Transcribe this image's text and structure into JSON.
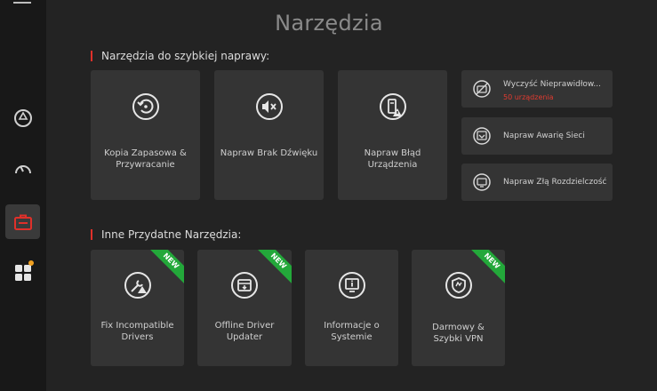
{
  "page_title": "Narzędzia",
  "sections": {
    "quick_fix_title": "Narzędzia do szybkiej naprawy:",
    "other_tools_title": "Inne Przydatne Narzędzia:"
  },
  "quick_tools": [
    {
      "label": "Kopia Zapasowa & Przywracanie",
      "icon": "backup-restore-icon"
    },
    {
      "label": "Napraw Brak Dźwięku",
      "icon": "speaker-mute-icon"
    },
    {
      "label": "Napraw Błąd Urządzenia",
      "icon": "device-error-icon"
    }
  ],
  "side_tools": [
    {
      "label": "Wyczyść Nieprawidłow...",
      "sub": "50 urządzenia",
      "icon": "invalid-device-icon"
    },
    {
      "label": "Napraw Awarię Sieci",
      "icon": "network-icon"
    },
    {
      "label": "Napraw Złą Rozdzielczość",
      "icon": "resolution-icon"
    }
  ],
  "other_tools": [
    {
      "label": "Fix Incompatible Drivers",
      "badge": "NEW",
      "icon": "wrench-warning-icon"
    },
    {
      "label": "Offline Driver Updater",
      "badge": "NEW",
      "icon": "offline-updater-icon"
    },
    {
      "label": "Informacje o Systemie",
      "icon": "system-info-icon"
    },
    {
      "label": "Darmowy & Szybki VPN",
      "badge": "NEW",
      "icon": "vpn-shield-icon"
    }
  ],
  "colors": {
    "accent": "#e0302a",
    "badge": "#23a83a",
    "warning_dot": "#f0a020"
  }
}
